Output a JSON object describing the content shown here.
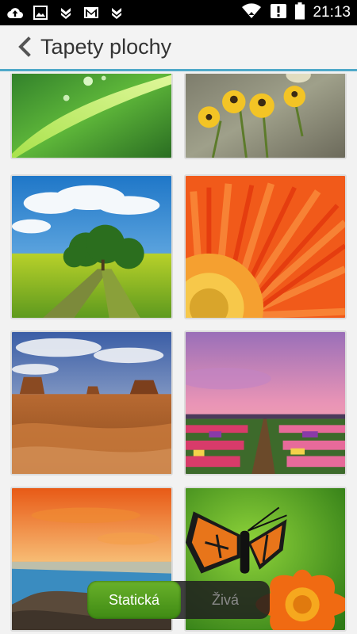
{
  "status_bar": {
    "time": "21:13",
    "left_icons": [
      "cloud-upload-icon",
      "image-icon",
      "chevron-stack-icon",
      "gmail-icon",
      "chevron-stack-icon"
    ],
    "right_icons": [
      "wifi-icon",
      "alert-icon",
      "battery-icon"
    ]
  },
  "header": {
    "title": "Tapety plochy",
    "back_icon": "chevron-left-icon",
    "accent": "#4fa9c9"
  },
  "wallpapers": [
    {
      "name": "green-leaf-dew"
    },
    {
      "name": "yellow-flowers"
    },
    {
      "name": "green-field-trees"
    },
    {
      "name": "orange-gerbera"
    },
    {
      "name": "monument-valley"
    },
    {
      "name": "tulip-field-sunset"
    },
    {
      "name": "sea-sunset"
    },
    {
      "name": "butterfly-flower"
    }
  ],
  "mode_toggle": {
    "static_label": "Statická",
    "live_label": "Živá",
    "selected": "static",
    "accent": "#5aa31f"
  }
}
